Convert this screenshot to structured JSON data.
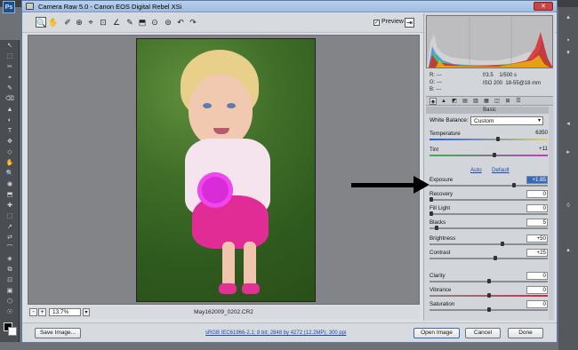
{
  "app": {
    "ps_logo": "Ps",
    "title": "Camera Raw 5.0  -  Canon EOS Digital Rebel XSi",
    "close_btn": "✕"
  },
  "ps_tools": [
    "↖",
    "⬚",
    "✂",
    "⌖",
    "✎",
    "⌫",
    "▲",
    "◐",
    "T",
    "✥",
    "◇",
    "✋",
    "🔍",
    "◉",
    "⬒",
    "✚",
    "⬚",
    "↗",
    "⇄",
    "⌒",
    "◈",
    "⧉",
    "⊡",
    "▣",
    "⬡",
    "☉"
  ],
  "ps_right_controls": [
    "▴",
    "▪",
    "▾",
    "◂",
    "▸",
    "◊",
    "▴"
  ],
  "toolbar": {
    "tools": [
      "🔍",
      "✋",
      "✐",
      "⊕",
      "⌖",
      "⊡",
      "∠",
      "✎",
      "⬒",
      "⊙",
      "⊜",
      "↶",
      "↷"
    ],
    "preview_label": "Preview",
    "preview_checked": "✓",
    "export_icon": "⇥"
  },
  "status": {
    "zoom_out": "-",
    "zoom_in": "+",
    "zoom": "13.7%",
    "zoom_drop": "▾",
    "filename": "May162009_0202.CR2"
  },
  "readout": {
    "r": "R:   ---",
    "g": "G:   ---",
    "b": "B:   ---",
    "aperture": "f/3.5",
    "shutter": "1/500 s",
    "iso": "ISO 200",
    "lens": "18-55@18 mm"
  },
  "panel_tabs": [
    "◉",
    "▲",
    "◩",
    "▤",
    "▥",
    "▦",
    "◫",
    "⊞",
    "☰"
  ],
  "basic": {
    "header": "Basic",
    "wb_label": "White Balance:",
    "wb_value": "Custom",
    "wb_drop": "▾",
    "auto": "Auto",
    "default": "Default",
    "sliders": [
      {
        "label": "Temperature",
        "value": "6350",
        "pos": 0.58,
        "track": "temp",
        "box": false
      },
      {
        "label": "Tint",
        "value": "+11",
        "pos": 0.55,
        "track": "tint",
        "box": false
      },
      {
        "label": "Exposure",
        "value": "+1.85",
        "pos": 0.72,
        "track": "",
        "box": true,
        "selected": true
      },
      {
        "label": "Recovery",
        "value": "0",
        "pos": 0.0,
        "track": "",
        "box": true
      },
      {
        "label": "Fill Light",
        "value": "0",
        "pos": 0.0,
        "track": "",
        "box": true
      },
      {
        "label": "Blacks",
        "value": "5",
        "pos": 0.05,
        "track": "",
        "box": true
      },
      {
        "label": "Brightness",
        "value": "+50",
        "pos": 0.62,
        "track": "",
        "box": true
      },
      {
        "label": "Contrast",
        "value": "+25",
        "pos": 0.56,
        "track": "",
        "box": true
      },
      {
        "label": "Clarity",
        "value": "0",
        "pos": 0.5,
        "track": "",
        "box": true
      },
      {
        "label": "Vibrance",
        "value": "0",
        "pos": 0.5,
        "track": "vib",
        "box": true
      },
      {
        "label": "Saturation",
        "value": "0",
        "pos": 0.5,
        "track": "",
        "box": true
      }
    ]
  },
  "footer": {
    "save": "Save Image...",
    "workflow": "sRGB IEC61966-2.1; 8 bit; 2848 by 4272 (12.2MP); 300 ppi",
    "open": "Open Image",
    "cancel": "Cancel",
    "done": "Done"
  },
  "colors": {
    "accent": "#316ac5",
    "link": "#1c47b3",
    "arrow": "#000000"
  }
}
